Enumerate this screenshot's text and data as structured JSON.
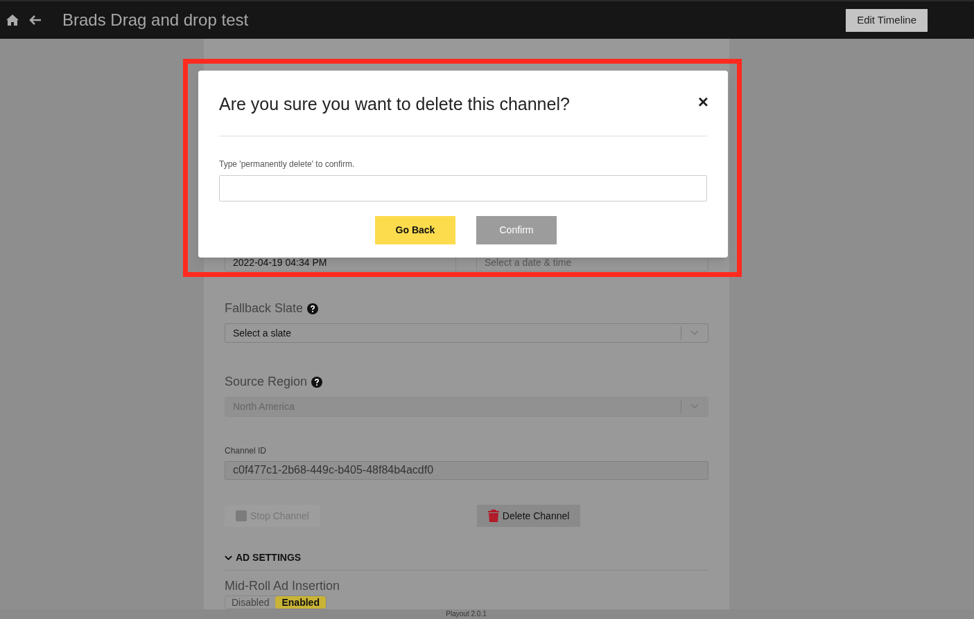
{
  "top_bar": {
    "title": "Brads Drag and drop test",
    "button": "Edit Timeline"
  },
  "form": {
    "schedule": {
      "start_value": "2022-04-19 04:34 PM",
      "end_placeholder": "Select a date & time"
    },
    "fields": [
      {
        "kind": "select",
        "label": "Fallback Slate",
        "help": true,
        "value": "Select a slate",
        "disabled": false
      },
      {
        "kind": "select",
        "label": "Source Region",
        "help": true,
        "value": "North America",
        "disabled": true
      },
      {
        "kind": "text",
        "label": "Channel ID",
        "value": "c0f477c1-2b68-449c-b405-48f84b4acdf0",
        "disabled": true
      }
    ],
    "buttons": [
      {
        "kind": "stop",
        "label": "Stop Channel",
        "disabled": true
      },
      {
        "kind": "delete",
        "label": "Delete Channel",
        "disabled": false
      }
    ],
    "ad_settings": {
      "title": "AD SETTINGS",
      "expanded": true,
      "mid_roll": {
        "label": "Mid-Roll Ad Insertion",
        "options": [
          {
            "label": "Disabled",
            "selected": false
          },
          {
            "label": "Enabled",
            "selected": true
          }
        ]
      }
    }
  },
  "modal": {
    "title": "Are you sure you want to delete this channel?",
    "close": "×",
    "prompt": "Type 'permanently delete' to confirm.",
    "buttons": [
      {
        "kind": "primary",
        "label": "Go Back",
        "disabled": false
      },
      {
        "kind": "secondary",
        "label": "Confirm",
        "disabled": true
      }
    ]
  },
  "footer": "Playout 2.0.1"
}
